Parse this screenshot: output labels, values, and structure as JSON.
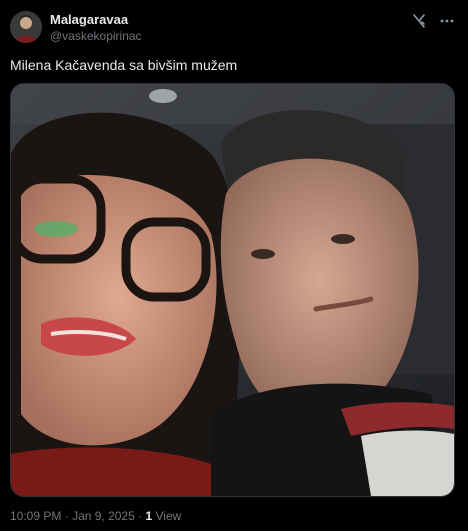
{
  "post": {
    "author": {
      "display_name": "Malagaravaa",
      "handle": "@vaskekopirinac"
    },
    "text": "Milena Kačavenda sa bivšim mužem",
    "time": "10:09 PM",
    "separator": "·",
    "date": "Jan 9, 2025",
    "views_count": "1",
    "views_label": "View"
  },
  "icons": {
    "grok": "grok-icon",
    "more": "more-icon"
  },
  "colors": {
    "background": "#000000",
    "text_primary": "#e7e9ea",
    "text_secondary": "#71767b",
    "border": "#2f3336"
  }
}
